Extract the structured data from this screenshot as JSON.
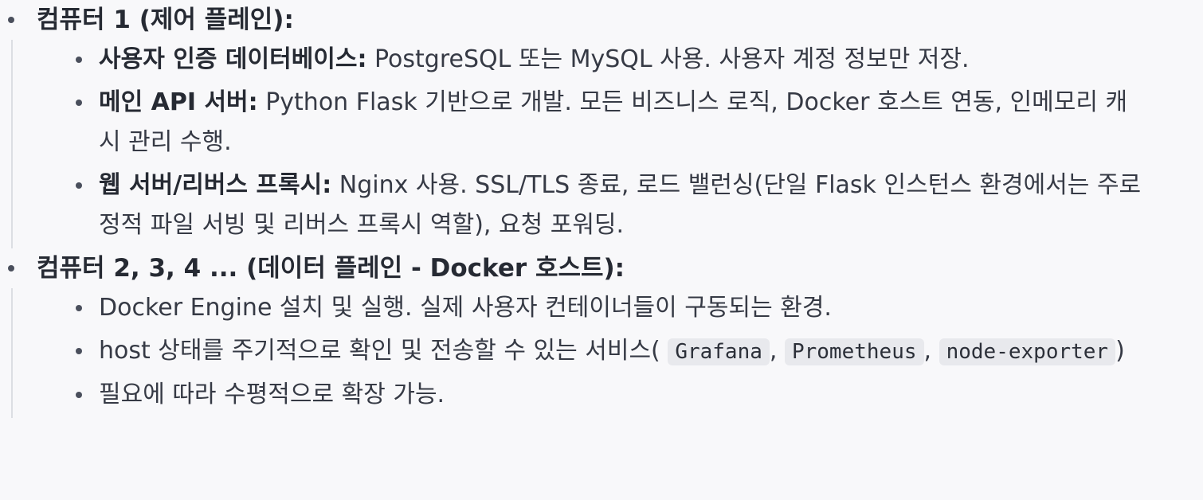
{
  "list": {
    "computer1": {
      "title": "컴퓨터 1 (제어 플레인):",
      "items": [
        {
          "term": "사용자 인증 데이터베이스:",
          "text": " PostgreSQL 또는 MySQL 사용. 사용자 계정 정보만 저장."
        },
        {
          "term": "메인 API 서버:",
          "text": " Python Flask 기반으로 개발. 모든 비즈니스 로직, Docker 호스트 연동, 인메모리 캐시 관리 수행."
        },
        {
          "term": "웹 서버/리버스 프록시:",
          "text": " Nginx 사용. SSL/TLS 종료, 로드 밸런싱(단일 Flask 인스턴스 환경에서는 주로 정적 파일 서빙 및 리버스 프록시 역할), 요청 포워딩."
        }
      ]
    },
    "computer2": {
      "title": "컴퓨터 2, 3, 4 ... (데이터 플레인 - Docker 호스트):",
      "items": [
        {
          "text": "Docker Engine 설치 및 실행. 실제 사용자 컨테이너들이 구동되는 환경."
        },
        {
          "text_before": "host 상태를 주기적으로 확인 및 전송할 수 있는 서비스(",
          "code1": "Grafana",
          "sep1": ", ",
          "code2": "Prometheus",
          "sep2": ", ",
          "code3": "node-exporter",
          "text_after": ")"
        },
        {
          "text": "필요에 따라 수평적으로 확장 가능."
        }
      ]
    }
  }
}
